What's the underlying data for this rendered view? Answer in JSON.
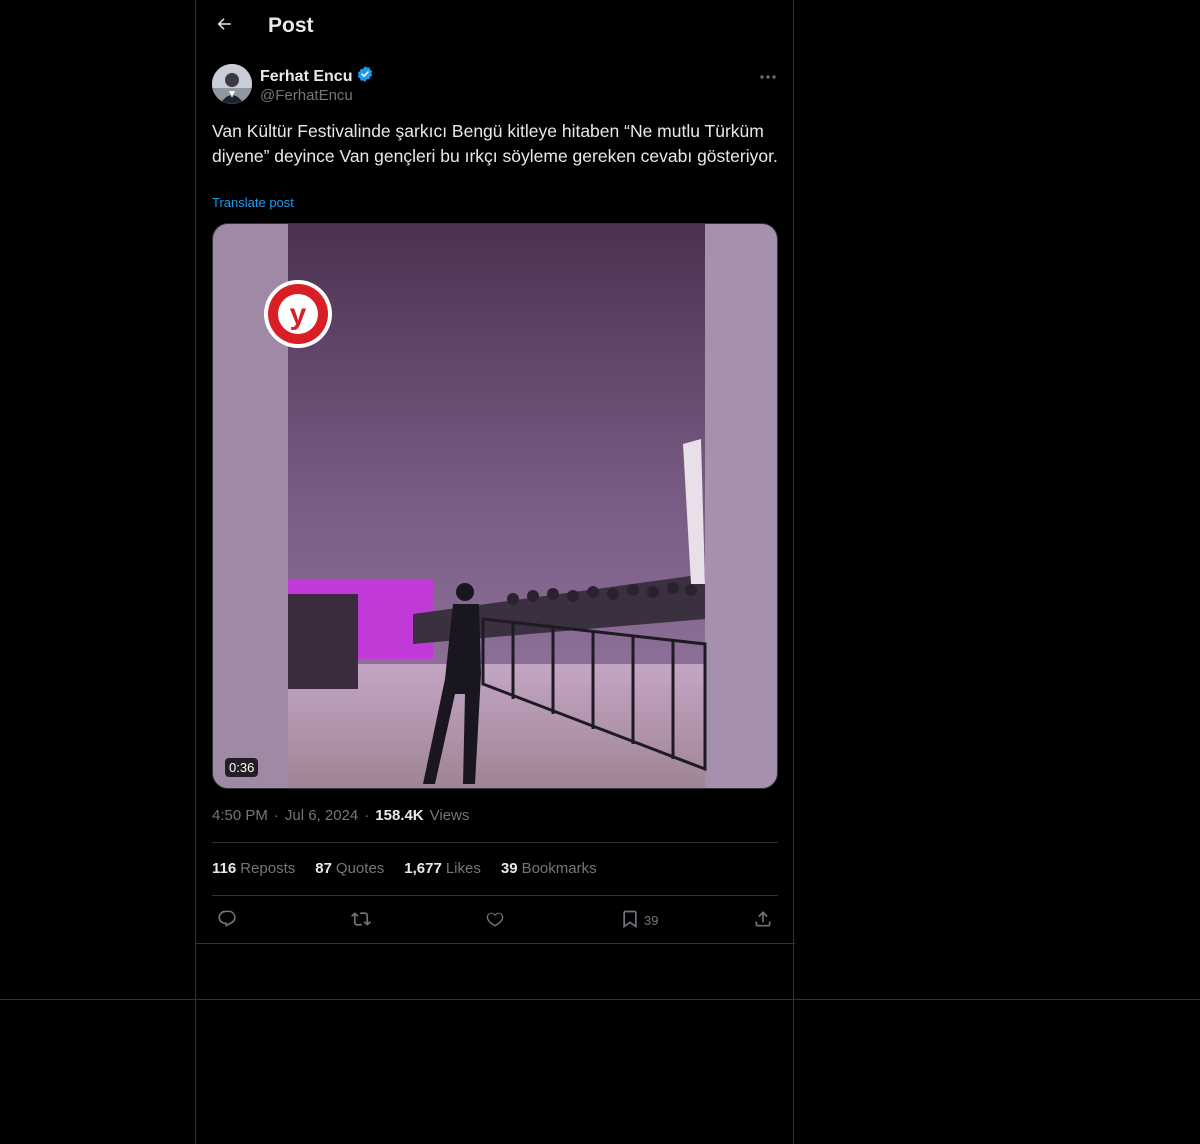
{
  "header": {
    "title": "Post"
  },
  "author": {
    "name": "Ferhat Encu",
    "handle": "@FerhatEncu",
    "verified": true
  },
  "post": {
    "text": "Van Kültür Festivalinde şarkıcı Bengü kitleye hitaben “Ne mutlu Türküm diyene” deyince Van gençleri bu ırkçı söyleme gereken cevabı gösteriyor.",
    "translate_label": "Translate post",
    "video_duration": "0:36",
    "time": "4:50 PM",
    "date": "Jul 6, 2024",
    "views_count": "158.4K",
    "views_label": "Views"
  },
  "stats": {
    "reposts_count": "116",
    "reposts_label": "Reposts",
    "quotes_count": "87",
    "quotes_label": "Quotes",
    "likes_count": "1,677",
    "likes_label": "Likes",
    "bookmarks_count": "39",
    "bookmarks_label": "Bookmarks"
  },
  "actions": {
    "bookmark_count": "39"
  },
  "colors": {
    "background": "#000000",
    "text": "#e7e9ea",
    "muted": "#71767b",
    "accent": "#1d9bf0",
    "border": "#2f3336"
  },
  "icons": [
    "back-arrow-icon",
    "verified-badge-icon",
    "more-icon",
    "reply-icon",
    "repost-icon",
    "like-icon",
    "bookmark-icon",
    "share-icon"
  ]
}
